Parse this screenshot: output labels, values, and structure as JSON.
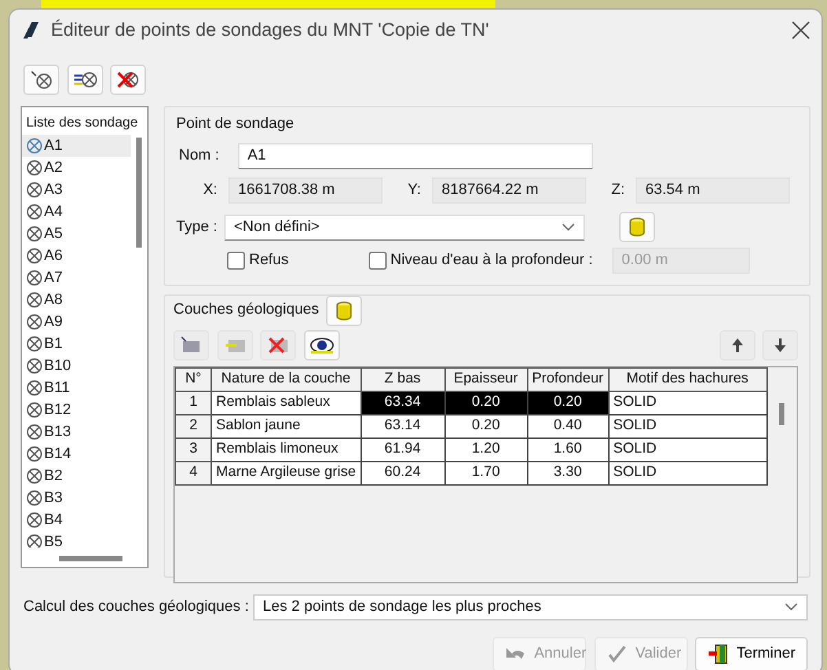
{
  "window": {
    "title": "Éditeur de points de sondages du MNT 'Copie de TN'"
  },
  "list": {
    "header": "Liste des sondage",
    "items": [
      {
        "label": "A1",
        "selected": true
      },
      {
        "label": "A2",
        "selected": false
      },
      {
        "label": "A3",
        "selected": false
      },
      {
        "label": "A4",
        "selected": false
      },
      {
        "label": "A5",
        "selected": false
      },
      {
        "label": "A6",
        "selected": false
      },
      {
        "label": "A7",
        "selected": false
      },
      {
        "label": "A8",
        "selected": false
      },
      {
        "label": "A9",
        "selected": false
      },
      {
        "label": "B1",
        "selected": false
      },
      {
        "label": "B10",
        "selected": false
      },
      {
        "label": "B11",
        "selected": false
      },
      {
        "label": "B12",
        "selected": false
      },
      {
        "label": "B13",
        "selected": false
      },
      {
        "label": "B14",
        "selected": false
      },
      {
        "label": "B2",
        "selected": false
      },
      {
        "label": "B3",
        "selected": false
      },
      {
        "label": "B4",
        "selected": false
      },
      {
        "label": "B5",
        "selected": false
      }
    ]
  },
  "point": {
    "legend": "Point de sondage",
    "name_label": "Nom :",
    "name_value": "A1",
    "coords": [
      {
        "label": "X:",
        "value": "1661708.38 m"
      },
      {
        "label": "Y:",
        "value": "8187664.22 m"
      },
      {
        "label": "Z:",
        "value": "63.54 m"
      }
    ],
    "type_label": "Type :",
    "type_value": "<Non défini>",
    "refus": {
      "label": "Refus",
      "checked": false
    },
    "water": {
      "label": "Niveau d'eau à la profondeur :",
      "checked": false
    },
    "depth": {
      "value": "0.00 m",
      "disabled": true
    }
  },
  "layers": {
    "legend": "Couches géologiques",
    "columns": [
      "N°",
      "Nature de la couche",
      "Z bas",
      "Epaisseur",
      "Profondeur",
      "Motif des hachures"
    ],
    "rows": [
      {
        "cells": [
          "1",
          "Remblais sableux",
          "63.34",
          "0.20",
          "0.20",
          "SOLID"
        ],
        "selected": true
      },
      {
        "cells": [
          "2",
          "Sablon jaune",
          "63.14",
          "0.20",
          "0.40",
          "SOLID"
        ],
        "selected": false
      },
      {
        "cells": [
          "3",
          "Remblais limoneux",
          "61.94",
          "1.20",
          "1.60",
          "SOLID"
        ],
        "selected": false
      },
      {
        "cells": [
          "4",
          "Marne Argileuse grise",
          "60.24",
          "1.70",
          "3.30",
          "SOLID"
        ],
        "selected": false
      }
    ]
  },
  "calc": {
    "label": "Calcul des couches géologiques :",
    "value": "Les 2 points de sondage les plus proches"
  },
  "buttons": [
    {
      "label": "Annuler",
      "kind": "undo",
      "disabled": true
    },
    {
      "label": "Valider",
      "kind": "check",
      "disabled": true
    },
    {
      "label": "Terminer",
      "kind": "exit",
      "disabled": false
    }
  ]
}
